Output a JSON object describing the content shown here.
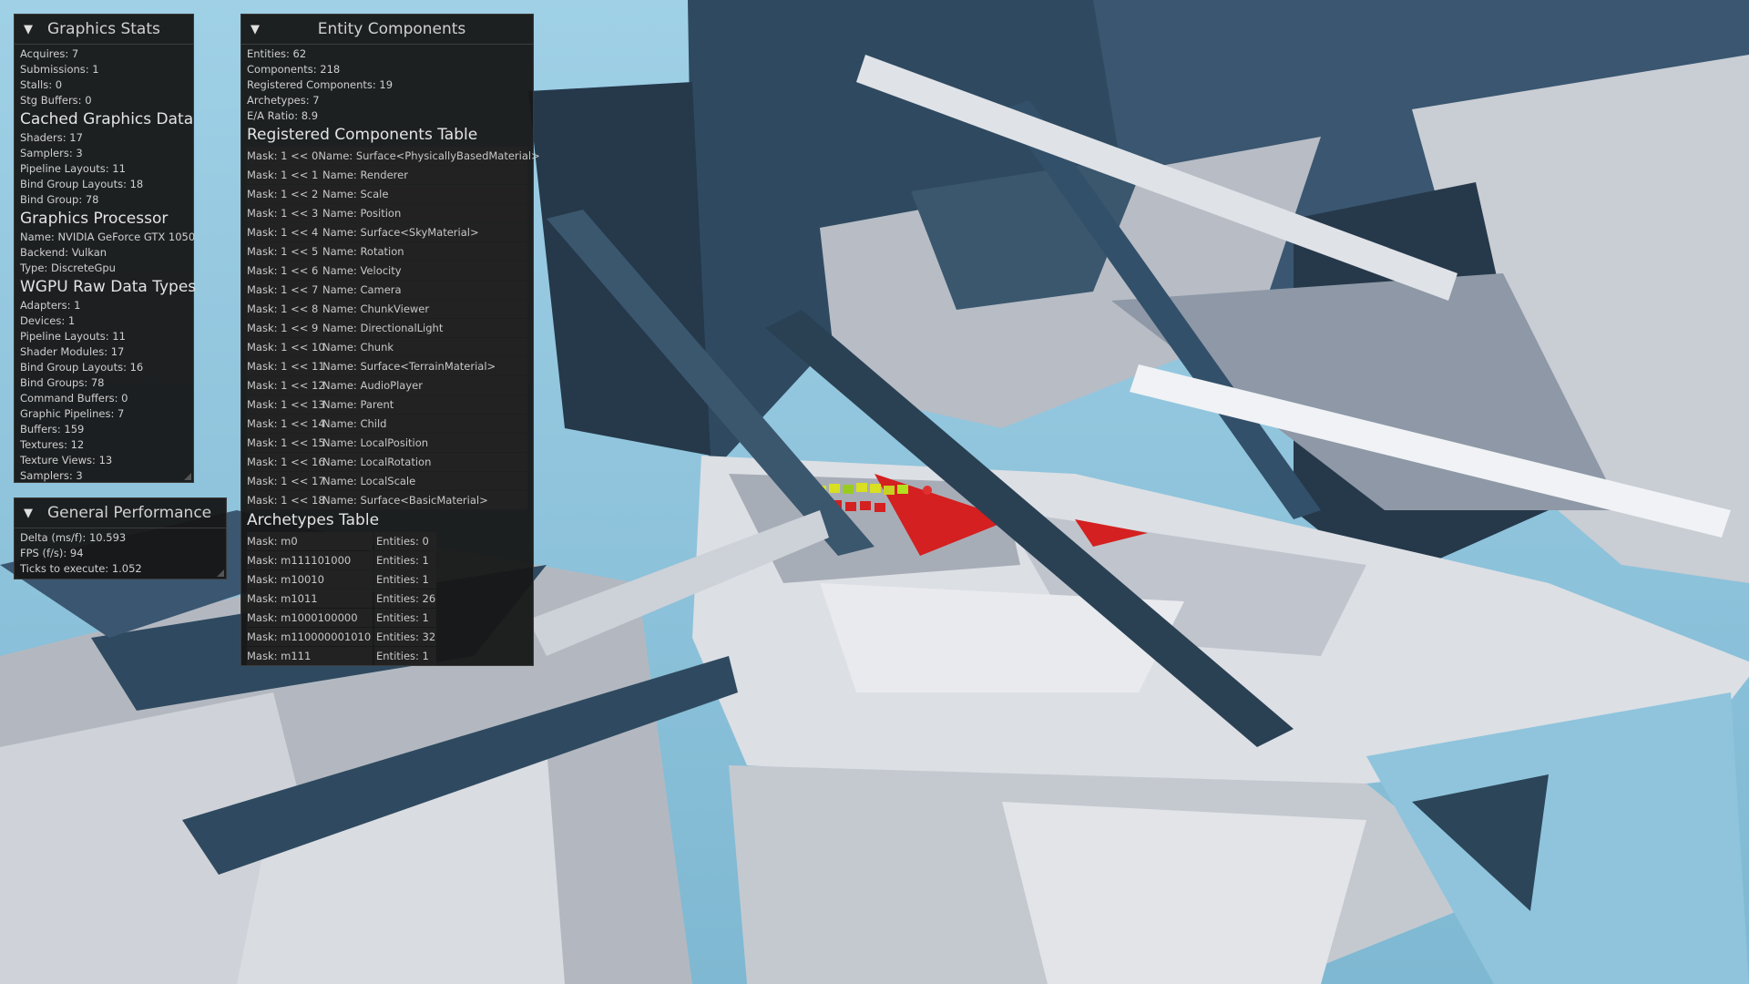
{
  "graphics_stats": {
    "title": "Graphics Stats",
    "stats": [
      "Acquires: 7",
      "Submissions: 1",
      "Stalls: 0",
      "Stg Buffers: 0"
    ],
    "cached_header": "Cached Graphics Data",
    "cached": [
      "Shaders: 17",
      "Samplers: 3",
      "Pipeline Layouts: 11",
      "Bind Group Layouts: 18",
      "Bind Group: 78"
    ],
    "processor_header": "Graphics Processor",
    "processor": [
      "Name: NVIDIA GeForce GTX 1050",
      "Backend: Vulkan",
      "Type: DiscreteGpu"
    ],
    "wgpu_header": "WGPU Raw Data Types",
    "wgpu": [
      "Adapters: 1",
      "Devices: 1",
      "Pipeline Layouts: 11",
      "Shader Modules: 17",
      "Bind Group Layouts: 16",
      "Bind Groups: 78",
      "Command Buffers: 0",
      "Graphic Pipelines: 7",
      "Buffers: 159",
      "Textures: 12",
      "Texture Views: 13",
      "Samplers: 3"
    ]
  },
  "general_performance": {
    "title": "General Performance",
    "lines": [
      "Delta (ms/f): 10.593",
      "FPS (f/s): 94",
      "Ticks to execute: 1.052"
    ]
  },
  "entity_components": {
    "title": "Entity Components",
    "summary": [
      "Entities: 62",
      "Components: 218",
      "Registered Components: 19",
      "Archetypes: 7",
      "E/A Ratio: 8.9"
    ],
    "registered_header": "Registered Components Table",
    "registered": [
      {
        "mask": "Mask: 1 << 0",
        "name": "Name: Surface<PhysicallyBasedMaterial>"
      },
      {
        "mask": "Mask: 1 << 1",
        "name": "Name: Renderer"
      },
      {
        "mask": "Mask: 1 << 2",
        "name": "Name: Scale"
      },
      {
        "mask": "Mask: 1 << 3",
        "name": "Name: Position"
      },
      {
        "mask": "Mask: 1 << 4",
        "name": "Name: Surface<SkyMaterial>"
      },
      {
        "mask": "Mask: 1 << 5",
        "name": "Name: Rotation"
      },
      {
        "mask": "Mask: 1 << 6",
        "name": "Name: Velocity"
      },
      {
        "mask": "Mask: 1 << 7",
        "name": "Name: Camera"
      },
      {
        "mask": "Mask: 1 << 8",
        "name": "Name: ChunkViewer"
      },
      {
        "mask": "Mask: 1 << 9",
        "name": "Name: DirectionalLight"
      },
      {
        "mask": "Mask: 1 << 10",
        "name": "Name: Chunk"
      },
      {
        "mask": "Mask: 1 << 11",
        "name": "Name: Surface<TerrainMaterial>"
      },
      {
        "mask": "Mask: 1 << 12",
        "name": "Name: AudioPlayer"
      },
      {
        "mask": "Mask: 1 << 13",
        "name": "Name: Parent"
      },
      {
        "mask": "Mask: 1 << 14",
        "name": "Name: Child"
      },
      {
        "mask": "Mask: 1 << 15",
        "name": "Name: LocalPosition"
      },
      {
        "mask": "Mask: 1 << 16",
        "name": "Name: LocalRotation"
      },
      {
        "mask": "Mask: 1 << 17",
        "name": "Name: LocalScale"
      },
      {
        "mask": "Mask: 1 << 18",
        "name": "Name: Surface<BasicMaterial>"
      }
    ],
    "archetypes_header": "Archetypes Table",
    "archetypes": [
      {
        "mask": "Mask: m0",
        "entities": "Entities: 0"
      },
      {
        "mask": "Mask: m111101000",
        "entities": "Entities: 1"
      },
      {
        "mask": "Mask: m10010",
        "entities": "Entities: 1"
      },
      {
        "mask": "Mask: m1011",
        "entities": "Entities: 26"
      },
      {
        "mask": "Mask: m1000100000",
        "entities": "Entities: 1"
      },
      {
        "mask": "Mask: m110000001010",
        "entities": "Entities: 32"
      },
      {
        "mask": "Mask: m111",
        "entities": "Entities: 1"
      }
    ]
  },
  "colors": {
    "sky": "#8fc4dc",
    "shape_dark": "#2f4a60",
    "shape_light": "#d4d8de",
    "panel_bg": "#161616",
    "accent_red": "#d42020",
    "accent_yellow": "#d8e020"
  },
  "icons": {
    "collapse_toggle": "triangle-down-icon",
    "resize_grip": "resize-grip-icon"
  }
}
